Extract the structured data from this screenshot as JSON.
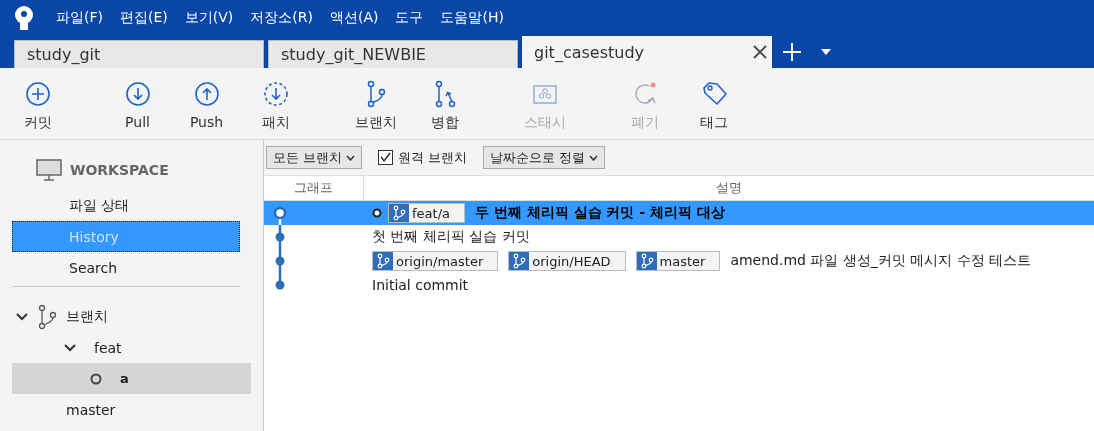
{
  "menu": [
    "파일(F)",
    "편집(E)",
    "보기(V)",
    "저장소(R)",
    "액션(A)",
    "도구",
    "도움말(H)"
  ],
  "tabs": [
    {
      "label": "study_git",
      "selected": false
    },
    {
      "label": "study_git_NEWBIE",
      "selected": false
    },
    {
      "label": "git_casestudy",
      "selected": true
    }
  ],
  "toolbar": [
    {
      "label": "커밋",
      "kind": "commit",
      "disabled": false
    },
    {
      "label": "Pull",
      "kind": "pull",
      "disabled": false
    },
    {
      "label": "Push",
      "kind": "push",
      "disabled": false
    },
    {
      "label": "패치",
      "kind": "fetch",
      "disabled": false
    },
    {
      "label": "브랜치",
      "kind": "branch",
      "disabled": false
    },
    {
      "label": "병합",
      "kind": "merge",
      "disabled": false
    },
    {
      "label": "스태시",
      "kind": "stash",
      "disabled": true
    },
    {
      "label": "폐기",
      "kind": "discard",
      "disabled": true
    },
    {
      "label": "태그",
      "kind": "tag",
      "disabled": false
    }
  ],
  "sidebar": {
    "workspace": {
      "title": "WORKSPACE",
      "items": [
        {
          "label": "파일 상태",
          "selected": false
        },
        {
          "label": "History",
          "selected": true
        },
        {
          "label": "Search",
          "selected": false
        }
      ]
    },
    "branches": {
      "title": "브랜치",
      "expanded": true,
      "children": [
        {
          "label": "feat",
          "expanded": true,
          "children": [
            {
              "label": "a",
              "selected": true,
              "current": true
            }
          ]
        },
        {
          "label": "master",
          "selected": false,
          "current": false
        }
      ]
    }
  },
  "filters": {
    "branch_dropdown": "모든 브랜치",
    "remote_branches": {
      "label": "원격 브랜치",
      "checked": true
    },
    "sort_dropdown": "날짜순으로 정렬"
  },
  "history": {
    "columns": [
      "그래프",
      "설명"
    ],
    "rows": [
      {
        "selected": true,
        "head": true,
        "refs": [
          "feat/a"
        ],
        "message": "두 번째 체리픽 실습 커밋 - 체리픽 대상"
      },
      {
        "selected": false,
        "head": false,
        "message": "첫 번째 체리픽 실습 커밋"
      },
      {
        "selected": false,
        "head": false,
        "refs": [
          "origin/master",
          "origin/HEAD",
          "master"
        ],
        "message": "amend.md 파일 생성_커밋 메시지 수정 테스트"
      },
      {
        "selected": false,
        "head": false,
        "message": "Initial commit"
      }
    ]
  }
}
